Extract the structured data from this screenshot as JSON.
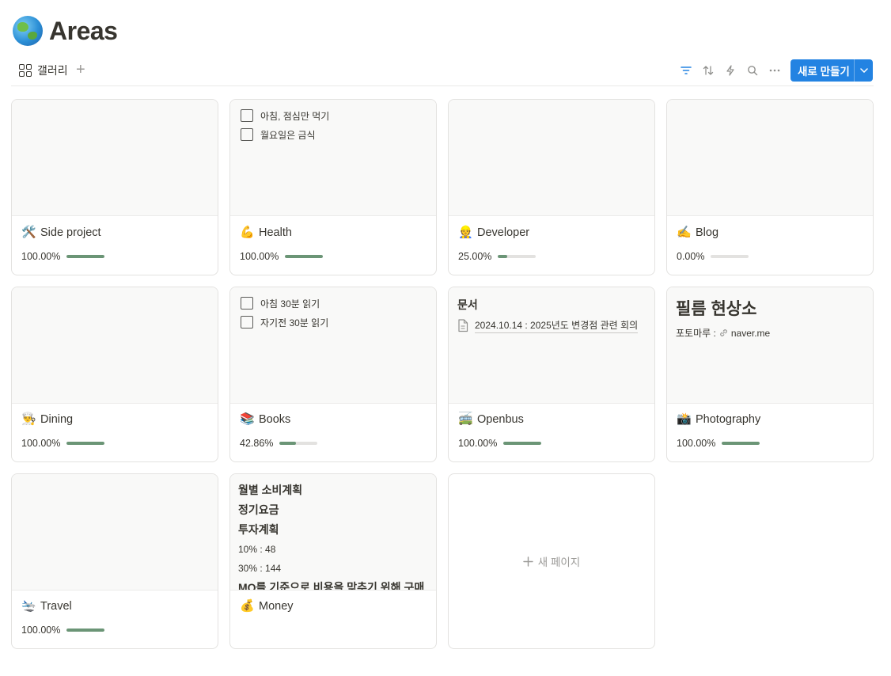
{
  "page": {
    "title": "Areas",
    "icon": "globe-asia-icon"
  },
  "view": {
    "tab_label": "갤러리",
    "new_button_label": "새로 만들기"
  },
  "toolbar_icons": [
    "filter-icon",
    "sort-icon",
    "automation-icon",
    "search-icon",
    "more-icon"
  ],
  "cards": {
    "c0": {
      "icon": "🛠️",
      "title": "Side project",
      "progress_text": "100.00%",
      "progress": 1.0
    },
    "c1": {
      "icon": "💪",
      "title": "Health",
      "progress_text": "100.00%",
      "progress": 1.0,
      "preview": {
        "todos": [
          "아침, 점심만 먹기",
          "월요일은 금식"
        ]
      }
    },
    "c2": {
      "icon": "👷",
      "title": "Developer",
      "progress_text": "25.00%",
      "progress": 0.25
    },
    "c3": {
      "icon": "✍️",
      "title": "Blog",
      "progress_text": "0.00%",
      "progress": 0.0
    },
    "c4": {
      "icon": "👨‍🍳",
      "title": "Dining",
      "progress_text": "100.00%",
      "progress": 1.0
    },
    "c5": {
      "icon": "📚",
      "title": "Books",
      "progress_text": "42.86%",
      "progress": 0.4286,
      "preview": {
        "todos": [
          "아침 30분 읽기",
          "자기전 30분 읽기"
        ]
      }
    },
    "c6": {
      "icon": "🚎",
      "title": "Openbus",
      "progress_text": "100.00%",
      "progress": 1.0,
      "preview": {
        "heading": "문서",
        "link": "2024.10.14 : 2025년도 변경점 관련 회의"
      }
    },
    "c7": {
      "icon": "📸",
      "title": "Photography",
      "progress_text": "100.00%",
      "progress": 1.0,
      "preview": {
        "heading": "필름 현상소",
        "line_label": "포토마루 :",
        "line_link": "naver.me"
      }
    },
    "c8": {
      "icon": "🛬",
      "title": "Travel",
      "progress_text": "100.00%",
      "progress": 1.0
    },
    "c9": {
      "icon": "💰",
      "title": "Money",
      "preview": {
        "lines": [
          "월별 소비계획",
          "정기요금",
          "투자계획"
        ],
        "small": [
          "10% : 48",
          "30% : 144"
        ],
        "cut_line": "MQ를 기준으로 비용을 맞추기 위해 구매"
      }
    }
  },
  "new_page_label": "새 페이지",
  "colors": {
    "accent": "#2383e2",
    "progress_fill": "#6b9576",
    "progress_track": "#e3e2e0"
  }
}
